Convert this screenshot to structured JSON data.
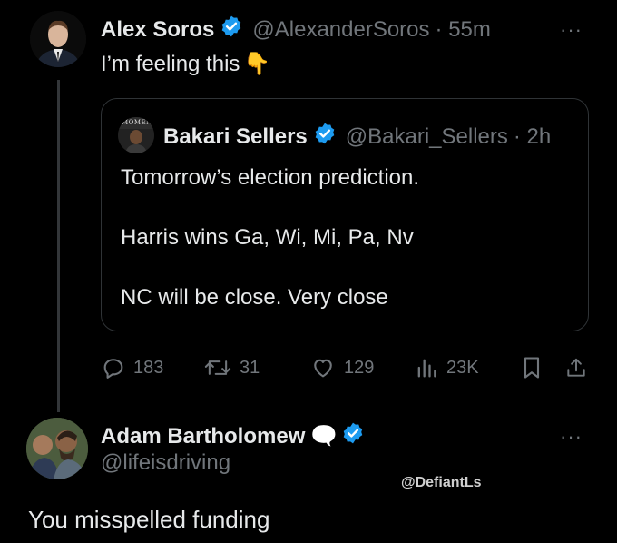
{
  "tweet": {
    "author_name": "Alex Soros",
    "author_handle": "@AlexanderSoros",
    "time": "· 55m",
    "text": "I’m feeling this",
    "emoji": "👇",
    "more": "···"
  },
  "quote": {
    "avatar_text": "MOMENT",
    "author_name": "Bakari Sellers",
    "author_handle": "@Bakari_Sellers",
    "time": "· 2h",
    "lines": [
      "Tomorrow’s election prediction.",
      "Harris wins Ga, Wi, Mi, Pa, Nv",
      "NC will be close. Very close"
    ]
  },
  "actions": {
    "replies": "183",
    "retweets": "31",
    "likes": "129",
    "views": "23K"
  },
  "reply": {
    "author_name": "Adam Bartholomew",
    "author_emoji": "🗨️",
    "author_handle": "@lifeisdriving",
    "text": "You misspelled funding",
    "more": "···"
  },
  "watermark": "@DefiantLs",
  "colors": {
    "background": "#000000",
    "text": "#e7e9ea",
    "muted": "#71767b",
    "verified": "#1d9bf0",
    "border": "#2f3336"
  }
}
